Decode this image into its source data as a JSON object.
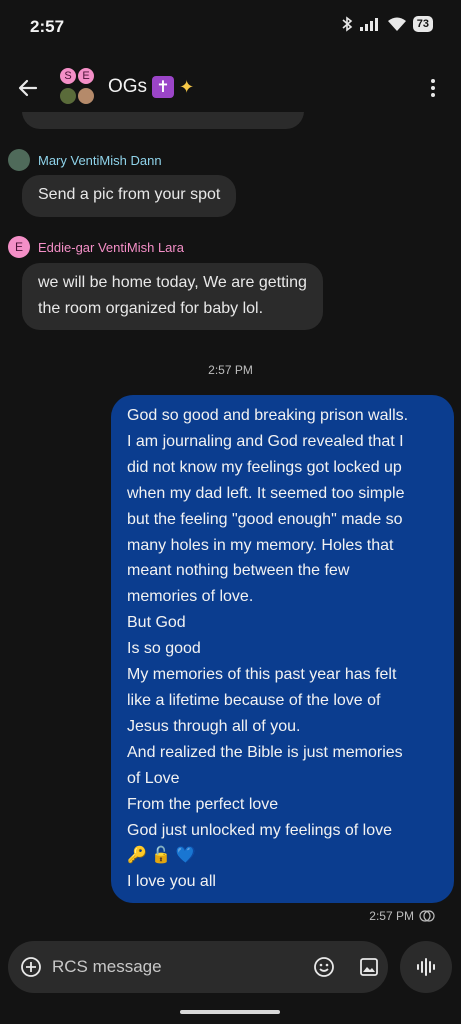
{
  "status_bar": {
    "time": "2:57",
    "battery": "73"
  },
  "header": {
    "title": "OGs",
    "avatar_letters": [
      "S",
      "E"
    ],
    "title_emoji_1": "✝️",
    "title_emoji_2": "✨"
  },
  "messages": {
    "mary": {
      "sender": "Mary VentiMish Dann",
      "text": "Send a pic from your spot",
      "name_color": "#8fd3ea"
    },
    "eddie": {
      "sender": "Eddie-gar VentiMish Lara",
      "avatar_letter": "E",
      "lines": [
        "we will be home today, We are getting",
        "the room organized for baby lol."
      ],
      "name_color": "#f48fc7"
    },
    "divider_time": "2:57 PM",
    "sent": {
      "lines": [
        "God so good and breaking prison walls.",
        "I am journaling and God revealed that I",
        "did not know my feelings got locked up",
        "when my dad left. It seemed too simple",
        "but the feeling \"good enough\" made so",
        "many holes in my memory. Holes that",
        "meant nothing between the few",
        "memories of love.",
        "But God",
        "Is so good",
        "My memories of this past year has felt",
        "like a lifetime because of the love of",
        "Jesus through all of you.",
        "And realized the Bible is just memories",
        "of Love",
        "From the perfect love",
        "God just unlocked my feelings of love",
        "🔑 🔓 💙",
        "I love you all"
      ],
      "time": "2:57 PM",
      "bubble_color": "#0b3d8f"
    }
  },
  "composer": {
    "placeholder": "RCS message"
  },
  "icons": {
    "back": "back-arrow-icon",
    "more": "more-vert-icon",
    "add": "add-circle-icon",
    "emoji": "emoji-icon",
    "gallery": "gallery-icon",
    "voice": "voice-waveform-icon"
  }
}
